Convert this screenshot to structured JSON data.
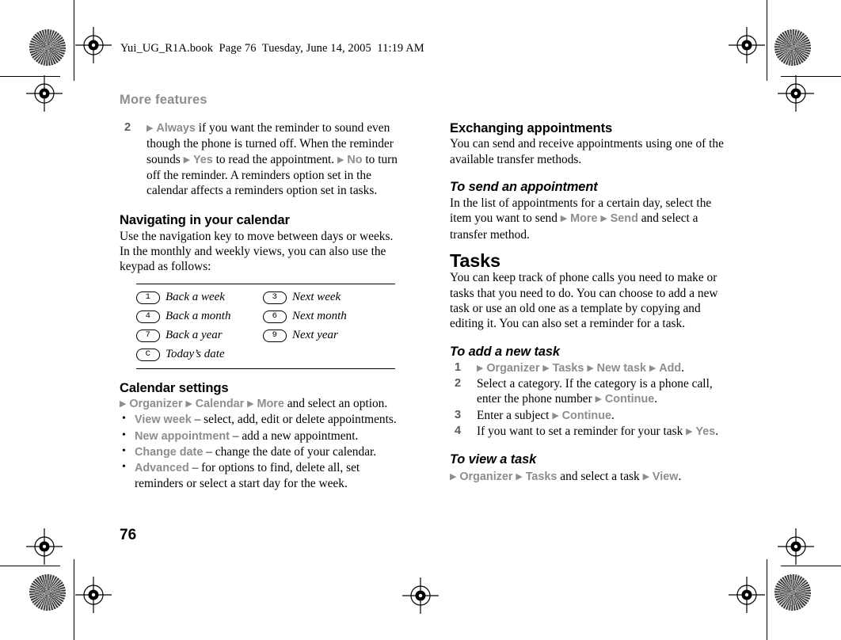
{
  "page": {
    "header_line": "Yui_UG_R1A.book  Page 76  Tuesday, June 14, 2005  11:19 AM",
    "running_head": "More features",
    "folio": "76",
    "colors": {
      "ui_term_gray": "#8d8d8d",
      "heading_black": "#000000",
      "running_head_gray": "#8d8d8d"
    }
  },
  "left_column": {
    "step2": {
      "number": "2",
      "seg1_arrow": "▶",
      "seg1_ui": "Always",
      "seg2_text": " if you want the reminder to sound even though the phone is turned off. When the reminder sounds ",
      "seg3_arrow": "▶",
      "seg3_ui": "Yes",
      "seg4_text": " to read the appointment. ",
      "seg5_arrow": "▶",
      "seg5_ui": "No",
      "seg6_text": " to turn off the reminder. A reminders option set in the calendar affects a reminders option set in tasks."
    },
    "navigating": {
      "heading": "Navigating in your calendar",
      "body": "Use the navigation key to move between days or weeks. In the monthly and weekly views, you can also use the keypad as follows:"
    },
    "keytable": {
      "rows": [
        {
          "left_key": "1",
          "left_label": "Back a week",
          "right_key": "3",
          "right_label": "Next week"
        },
        {
          "left_key": "4",
          "left_label": "Back a month",
          "right_key": "6",
          "right_label": "Next month"
        },
        {
          "left_key": "7",
          "left_label": "Back a year",
          "right_key": "9",
          "right_label": "Next year"
        },
        {
          "left_key": "C",
          "left_label": "Today’s date",
          "right_key": "",
          "right_label": ""
        }
      ]
    },
    "calendar_settings": {
      "heading": "Calendar settings",
      "path_arrow1": "▶",
      "path_ui1": "Organizer",
      "path_arrow2": "▶",
      "path_ui2": "Calendar",
      "path_arrow3": "▶",
      "path_ui3": "More",
      "path_tail": " and select an option.",
      "bullets": [
        {
          "term": "View week",
          "desc": " – select, add, edit or delete appointments."
        },
        {
          "term": "New appointment",
          "desc": " – add a new appointment."
        },
        {
          "term": "Change date",
          "desc": " – change the date of your calendar."
        },
        {
          "term": "Advanced",
          "desc": " – for options to find, delete all, set reminders or select a start day for the week."
        }
      ]
    }
  },
  "right_column": {
    "exchanging": {
      "heading": "Exchanging appointments",
      "body": "You can send and receive appointments using one of the available transfer methods."
    },
    "to_send": {
      "heading": "To send an appointment",
      "text_before": "In the list of appointments for a certain day, select the item you want to send ",
      "arrow1": "▶",
      "ui1": "More",
      "arrow2": "▶",
      "ui2": "Send",
      "text_after": " and select a transfer method."
    },
    "tasks": {
      "heading": "Tasks",
      "body": "You can keep track of phone calls you need to make or tasks that you need to do. You can choose to add a new task or use an old one as a template by copying and editing it. You can also set a reminder for a task."
    },
    "to_add": {
      "heading": "To add a new task",
      "steps": [
        {
          "number": "1",
          "a1": "▶",
          "u1": "Organizer",
          "a2": "▶",
          "u2": "Tasks",
          "a3": "▶",
          "u3": "New task",
          "a4": "▶",
          "u4": "Add",
          "tail": "."
        },
        {
          "number": "2",
          "lead": "Select a category. If the category is a phone call, enter the phone number ",
          "a1": "▶",
          "u1": "Continue",
          "tail": "."
        },
        {
          "number": "3",
          "lead": "Enter a subject ",
          "a1": "▶",
          "u1": "Continue",
          "tail": "."
        },
        {
          "number": "4",
          "lead": "If you want to set a reminder for your task ",
          "a1": "▶",
          "u1": "Yes",
          "tail": "."
        }
      ]
    },
    "to_view": {
      "heading": "To view a task",
      "a1": "▶",
      "u1": "Organizer",
      "a2": "▶",
      "u2": "Tasks",
      "mid": " and select a task ",
      "a3": "▶",
      "u3": "View",
      "tail": "."
    }
  }
}
